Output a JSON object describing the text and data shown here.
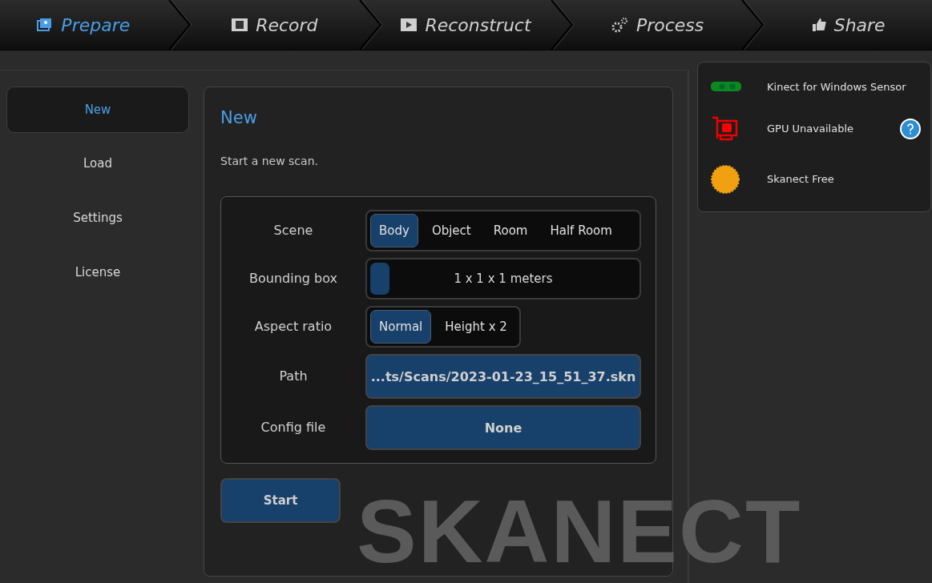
{
  "steps": [
    {
      "label": "Prepare",
      "selected": true
    },
    {
      "label": "Record",
      "selected": false
    },
    {
      "label": "Reconstruct",
      "selected": false
    },
    {
      "label": "Process",
      "selected": false
    },
    {
      "label": "Share",
      "selected": false
    }
  ],
  "sidebar": {
    "items": [
      {
        "label": "New",
        "selected": true
      },
      {
        "label": "Load",
        "selected": false
      },
      {
        "label": "Settings",
        "selected": false
      },
      {
        "label": "License",
        "selected": false
      }
    ]
  },
  "panel": {
    "title": "New",
    "description": "Start a new scan.",
    "fields": [
      {
        "kind": "segmented",
        "label": "Scene",
        "options": [
          {
            "label": "Body",
            "selected": true
          },
          {
            "label": "Object",
            "selected": false
          },
          {
            "label": "Room",
            "selected": false
          },
          {
            "label": "Half Room",
            "selected": false
          }
        ]
      },
      {
        "kind": "slider",
        "label": "Bounding box",
        "level": 0,
        "reading": "1 x 1 x 1 meters"
      },
      {
        "kind": "segmented",
        "label": "Aspect ratio",
        "options": [
          {
            "label": "Normal",
            "selected": true
          },
          {
            "label": "Height x 2",
            "selected": false
          }
        ]
      },
      {
        "kind": "button",
        "label": "Path",
        "value": "...ts/Scans/2023-01-23_15_51_37.skn"
      },
      {
        "kind": "button",
        "label": "Config file",
        "value": "None"
      }
    ],
    "start_button": "Start"
  },
  "status": [
    {
      "label": "Kinect for Windows Sensor",
      "help": false
    },
    {
      "label": "GPU Unavailable",
      "help": true
    },
    {
      "label": "Skanect Free",
      "help": false
    }
  ],
  "background_logo": "SKANECT"
}
